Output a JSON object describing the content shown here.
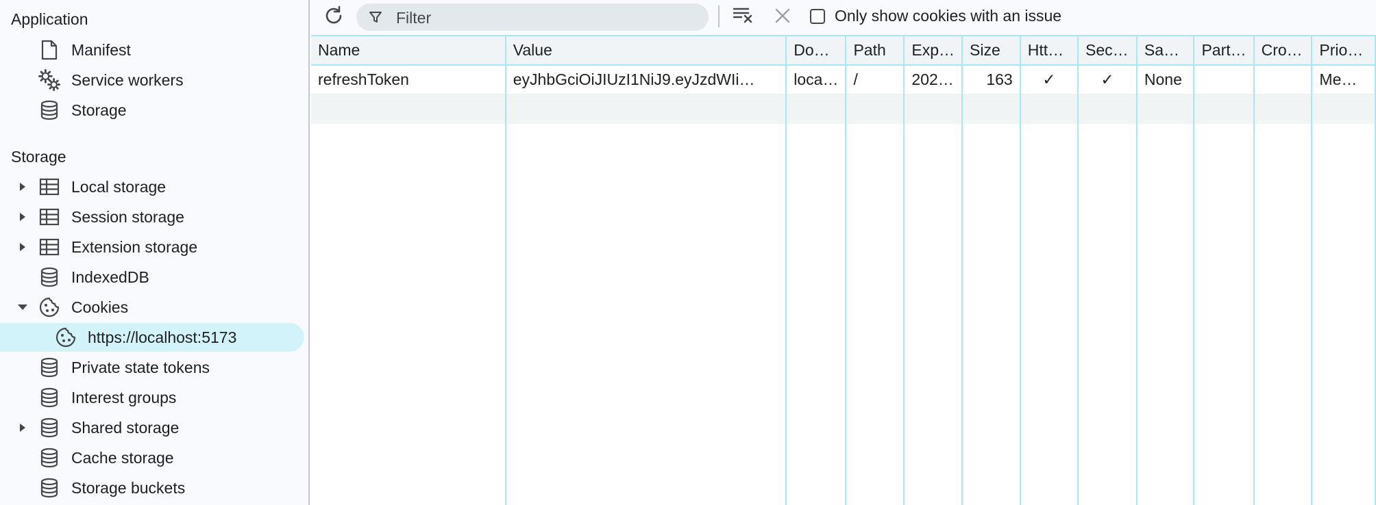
{
  "sidebar": {
    "application_title": "Application",
    "application_items": [
      {
        "label": "Manifest",
        "icon": "document-icon"
      },
      {
        "label": "Service workers",
        "icon": "gears-icon"
      },
      {
        "label": "Storage",
        "icon": "database-icon"
      }
    ],
    "storage_title": "Storage",
    "storage_items": [
      {
        "label": "Local storage",
        "icon": "table-icon",
        "expander": "collapsed"
      },
      {
        "label": "Session storage",
        "icon": "table-icon",
        "expander": "collapsed"
      },
      {
        "label": "Extension storage",
        "icon": "table-icon",
        "expander": "collapsed"
      },
      {
        "label": "IndexedDB",
        "icon": "database-icon"
      },
      {
        "label": "Cookies",
        "icon": "cookie-icon",
        "expander": "expanded"
      },
      {
        "label": "https://localhost:5173",
        "icon": "cookie-icon",
        "selected": true
      },
      {
        "label": "Private state tokens",
        "icon": "database-icon"
      },
      {
        "label": "Interest groups",
        "icon": "database-icon"
      },
      {
        "label": "Shared storage",
        "icon": "database-icon",
        "expander": "collapsed"
      },
      {
        "label": "Cache storage",
        "icon": "database-icon"
      },
      {
        "label": "Storage buckets",
        "icon": "database-icon"
      }
    ]
  },
  "toolbar": {
    "filter_placeholder": "Filter",
    "only_issues_label": "Only show cookies with an issue"
  },
  "table": {
    "columns": [
      "Name",
      "Value",
      "Do…",
      "Path",
      "Exp…",
      "Size",
      "Htt…",
      "Sec…",
      "Sa…",
      "Part…",
      "Cro…",
      "Prio…"
    ],
    "rows": [
      {
        "name": "refreshToken",
        "value": "eyJhbGciOiJIUzI1NiJ9.eyJzdWIi…",
        "domain": "loca…",
        "path": "/",
        "expires": "202…",
        "size": "163",
        "httponly": "✓",
        "secure": "✓",
        "samesite": "None",
        "partition": "",
        "crosssite": "",
        "priority": "Me…"
      }
    ]
  },
  "colors": {
    "accent_border": "#a8e8f5",
    "selected_bg": "#d3f3fb",
    "filter_bg": "#e2e8ec"
  }
}
